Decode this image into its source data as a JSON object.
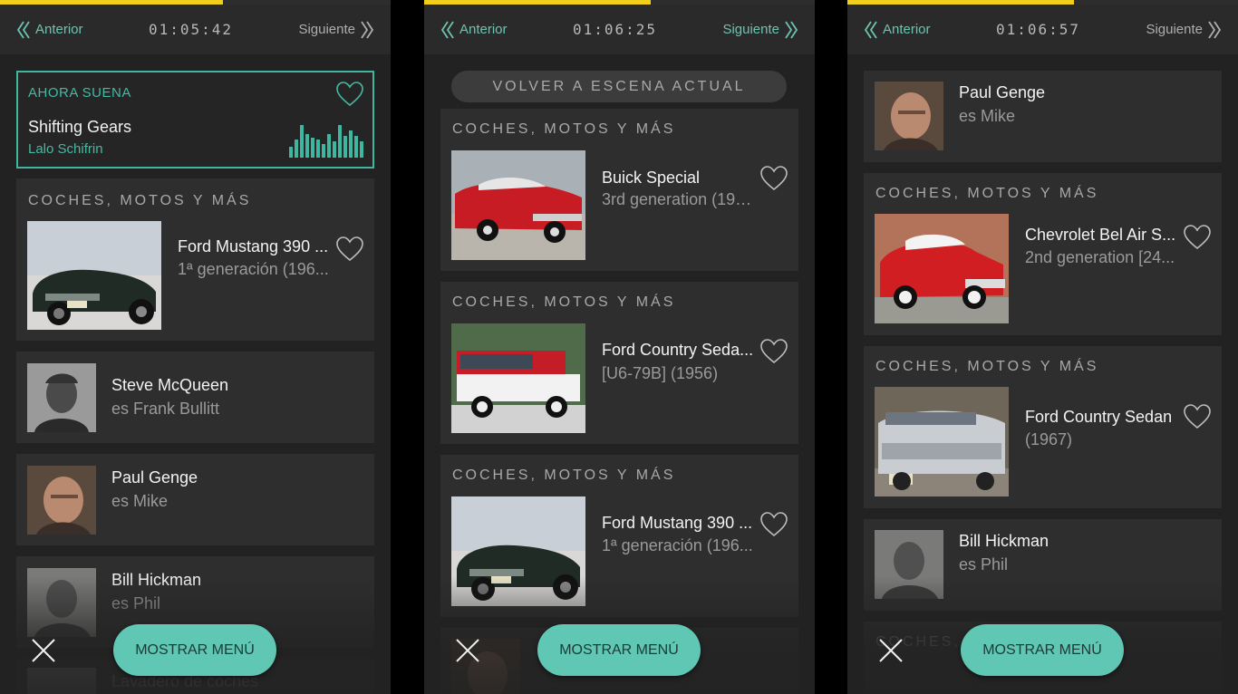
{
  "nav": {
    "prev_label": "Anterior",
    "next_label": "Siguiente"
  },
  "section_label": "COCHES, MOTOS Y MÁS",
  "menu_label": "MOSTRAR MENÚ",
  "colors": {
    "accent": "#5fc7b3",
    "progress": "#f2cf1d",
    "panel": "#2a2a2a",
    "card": "#2e2e2e"
  },
  "icons": [
    "chevrons-left-icon",
    "chevrons-right-icon",
    "heart-icon",
    "close-icon",
    "equalizer-icon"
  ],
  "panels": [
    {
      "time": "01:05:42",
      "progress": 0.57,
      "now_playing": {
        "label": "AHORA SUENA",
        "title": "Shifting Gears",
        "artist": "Lalo Schifrin"
      },
      "items": [
        {
          "title": "Ford Mustang 390 ...",
          "subtitle": "1ª generación (196..."
        },
        {
          "title": "Steve McQueen",
          "subtitle": "es Frank Bullitt"
        },
        {
          "title": "Paul Genge",
          "subtitle": "es Mike"
        },
        {
          "title": "Bill Hickman",
          "subtitle": "es Phil"
        },
        {
          "title": "Lavadero de coches"
        }
      ]
    },
    {
      "time": "01:06:25",
      "progress": 0.58,
      "back_label": "VOLVER A ESCENA ACTUAL",
      "items": [
        {
          "title": "Buick Special",
          "subtitle": "3rd generation (196..."
        },
        {
          "title": "Ford Country Seda...",
          "subtitle": "[U6-79B] (1956)"
        },
        {
          "title": "Ford Mustang 390 ...",
          "subtitle": "1ª generación (196..."
        }
      ]
    },
    {
      "time": "01:06:57",
      "progress": 0.58,
      "items": [
        {
          "title": "Paul Genge",
          "subtitle": "es Mike"
        },
        {
          "title": "Chevrolet Bel Air S...",
          "subtitle": "2nd generation [24..."
        },
        {
          "title": "Ford Country Sedan",
          "subtitle": "(1967)"
        },
        {
          "title": "Bill Hickman",
          "subtitle": "es Phil"
        }
      ]
    }
  ]
}
